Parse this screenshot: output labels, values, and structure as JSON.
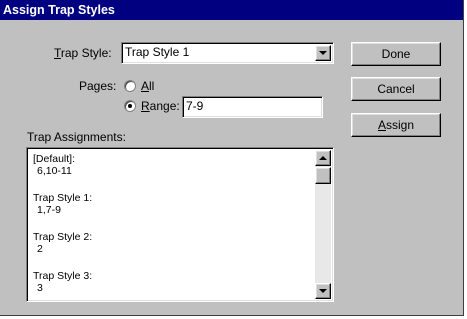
{
  "dialog": {
    "title": "Assign Trap Styles"
  },
  "trap_style": {
    "label_prefix": "",
    "label_underlined": "T",
    "label_rest": "rap Style:",
    "value": "Trap Style 1",
    "dropdown_icon": "triangle-down"
  },
  "pages": {
    "label": "Pages:",
    "options": [
      {
        "accel": "A",
        "rest": "ll",
        "selected": false
      },
      {
        "accel": "R",
        "rest": "ange:",
        "selected": true
      }
    ],
    "range_value": "7-9"
  },
  "assignments": {
    "label": "Trap Assignments:",
    "entries": [
      {
        "name": "[Default]:",
        "pages": "6,10-11"
      },
      {
        "name": "Trap Style 1:",
        "pages": "1,7-9"
      },
      {
        "name": "Trap Style 2:",
        "pages": "2"
      },
      {
        "name": "Trap Style 3:",
        "pages": "3"
      }
    ]
  },
  "buttons": {
    "done": "Done",
    "cancel": "Cancel",
    "assign_accel": "A",
    "assign_rest": "ssign"
  },
  "colors": {
    "titlebar": "#000080",
    "face": "#c0c0c0"
  }
}
